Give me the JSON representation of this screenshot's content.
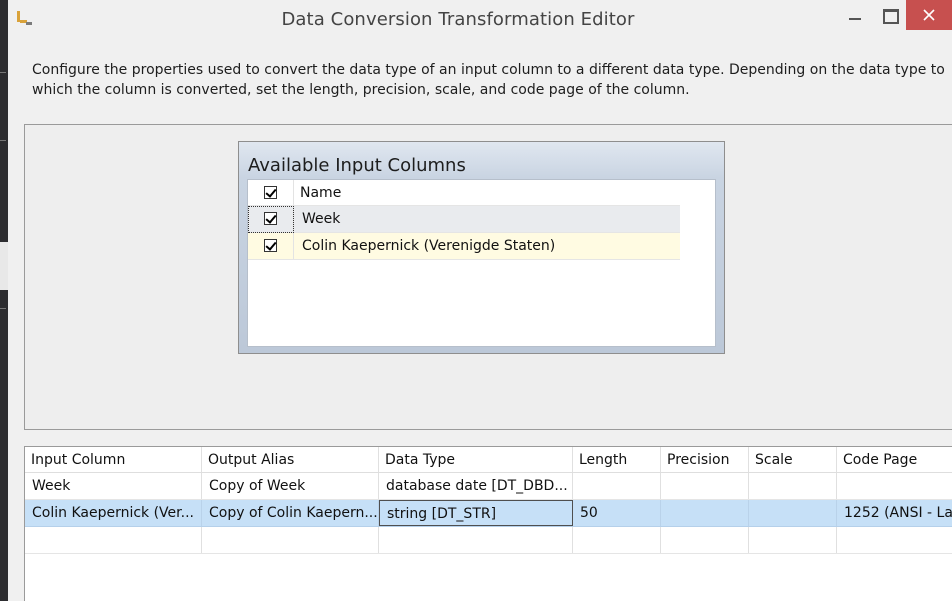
{
  "window": {
    "title": "Data Conversion Transformation Editor",
    "icon": "ssis-transform-icon",
    "close_color": "#c7504f"
  },
  "description": "Configure the properties used to convert the data type of an input column to a different data type. Depending on the data type to which the column is converted, set the length, precision, scale, and code page of the column.",
  "available_columns": {
    "title": "Available Input Columns",
    "header": {
      "name": "Name",
      "checked": true
    },
    "rows": [
      {
        "name": "Week",
        "checked": true
      },
      {
        "name": "Colin Kaepernick  (Verenigde Staten)",
        "checked": true
      }
    ]
  },
  "conversion_grid": {
    "headers": [
      "Input Column",
      "Output Alias",
      "Data Type",
      "Length",
      "Precision",
      "Scale",
      "Code Page"
    ],
    "rows": [
      [
        "Week",
        "Copy of Week",
        "database date [DT_DBD...",
        "",
        "",
        "",
        ""
      ],
      [
        "Colin Kaepernick  (Ver...",
        "Copy of Colin Kaepern...",
        "string [DT_STR]",
        "50",
        "",
        "",
        "1252  (ANSI - La"
      ]
    ],
    "selected_row": 1,
    "selection_color": "#c6e0f7"
  }
}
